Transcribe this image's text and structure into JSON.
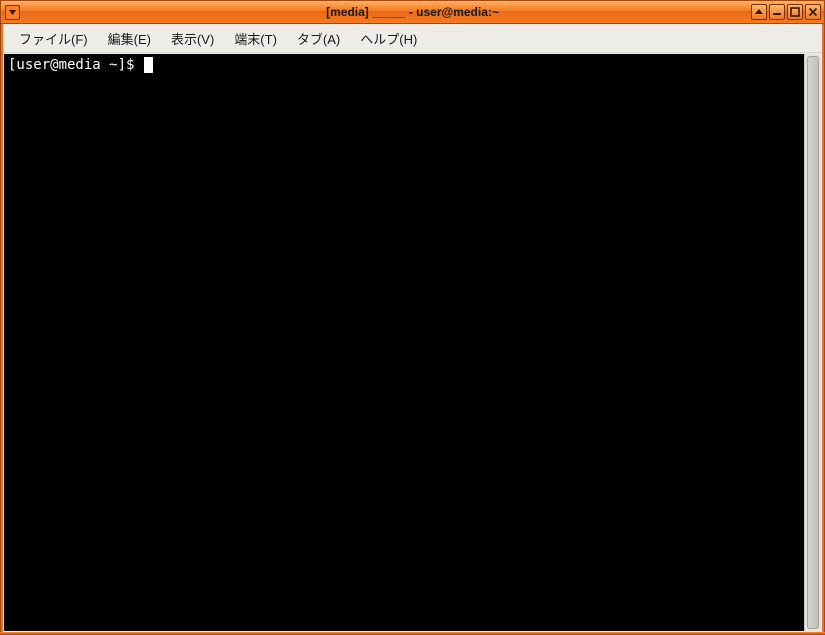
{
  "window": {
    "title": "[media] _____ - user@media:~"
  },
  "menubar": {
    "items": [
      {
        "label": "ファイル(F)"
      },
      {
        "label": "編集(E)"
      },
      {
        "label": "表示(V)"
      },
      {
        "label": "端末(T)"
      },
      {
        "label": "タブ(A)"
      },
      {
        "label": "ヘルプ(H)"
      }
    ]
  },
  "terminal": {
    "prompt": "[user@media ~]$ "
  }
}
